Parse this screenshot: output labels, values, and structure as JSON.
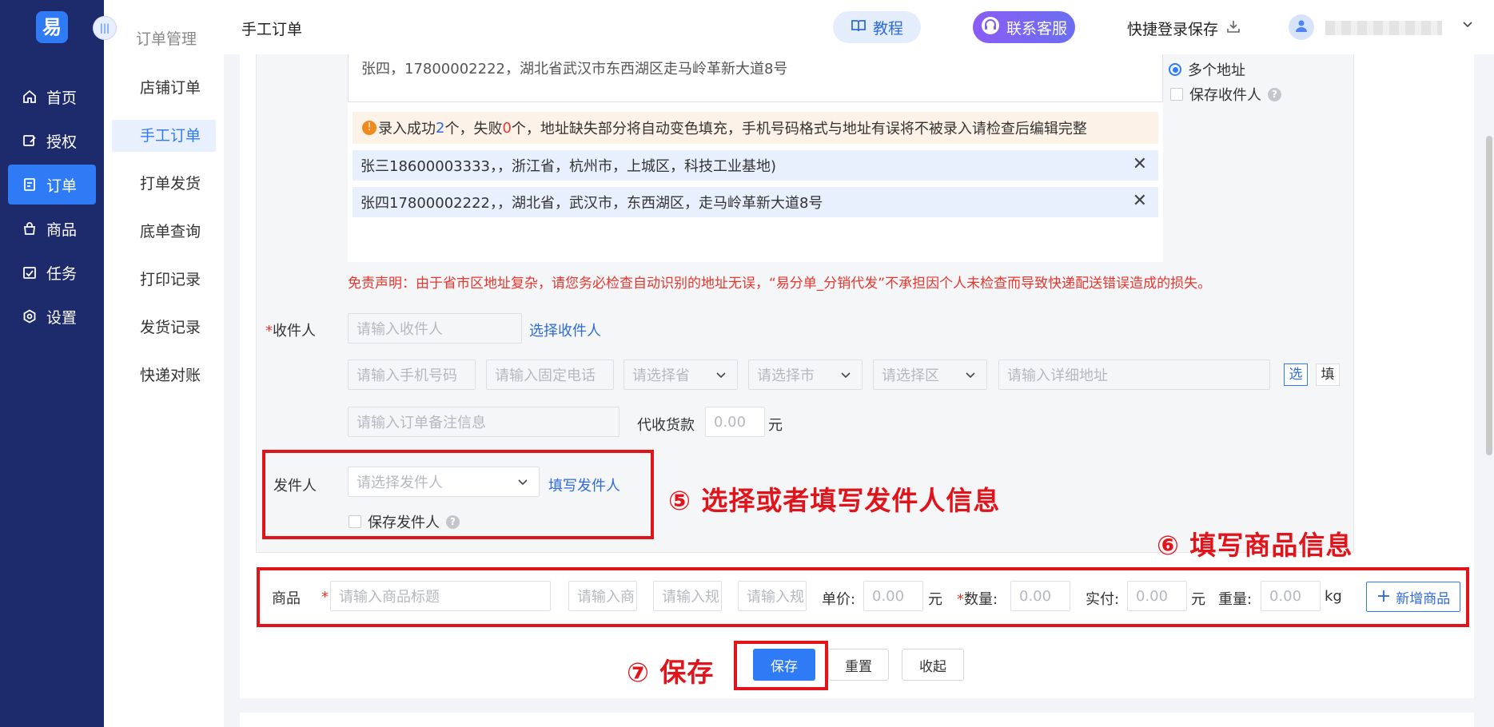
{
  "sidebar": {
    "logo": "易",
    "items": [
      {
        "label": "首页",
        "icon": "home-icon"
      },
      {
        "label": "授权",
        "icon": "auth-icon"
      },
      {
        "label": "订单",
        "icon": "order-icon",
        "active": true
      },
      {
        "label": "商品",
        "icon": "product-icon"
      },
      {
        "label": "任务",
        "icon": "task-icon"
      },
      {
        "label": "设置",
        "icon": "settings-icon"
      }
    ]
  },
  "subnav": {
    "title": "订单管理",
    "items": [
      {
        "label": "店铺订单"
      },
      {
        "label": "手工订单",
        "active": true
      },
      {
        "label": "打单发货"
      },
      {
        "label": "底单查询"
      },
      {
        "label": "打印记录"
      },
      {
        "label": "发货记录"
      },
      {
        "label": "快递对账"
      }
    ]
  },
  "topbar": {
    "page_title": "手工订单",
    "tutorial_label": "教程",
    "service_label": "联系客服",
    "quick_login_label": "快捷登录保存"
  },
  "form": {
    "textarea_value": "张四，17800002222，湖北省武汉市东西湖区走马岭革新大道8号",
    "radio_multi_label": "多个地址",
    "save_recipient_label": "保存收件人",
    "warning": {
      "pre": "录入成功 ",
      "success_count": "2",
      "mid": " 个，失败 ",
      "fail_count": "0",
      "post": " 个，地址缺失部分将自动变色填充，手机号码格式与地址有误将不被录入请检查后编辑完整"
    },
    "addresses": [
      "张三18600003333，，浙江省，杭州市，上城区，科技工业基地)",
      "张四17800002222，，湖北省，武汉市，东西湖区，走马岭革新大道8号"
    ],
    "disclaimer": "免责声明：由于省市区地址复杂，请您务必检查自动识别的地址无误，“易分单_分销代发”不承担因个人未检查而导致快递配送错误造成的损失。",
    "recipient": {
      "required_mark": "*",
      "label": "收件人",
      "name_placeholder": "请输入收件人",
      "select_link": "选择收件人",
      "mobile_placeholder": "请输入手机号码",
      "phone_placeholder": "请输入固定电话",
      "province_placeholder": "请选择省",
      "city_placeholder": "请选择市",
      "district_placeholder": "请选择区",
      "address_placeholder": "请输入详细地址",
      "btn_select": "选",
      "btn_fill": "填",
      "remark_placeholder": "请输入订单备注信息",
      "cod_label": "代收货款",
      "cod_value": "0.00",
      "cod_unit": "元"
    },
    "sender": {
      "label": "发件人",
      "select_placeholder": "请选择发件人",
      "fill_link": "填写发件人",
      "save_label": "保存发件人"
    },
    "product": {
      "label": "商品",
      "required_mark": "*",
      "title_placeholder": "请输入商品标题",
      "field2_placeholder": "请输入商",
      "field3_placeholder": "请输入规",
      "field4_placeholder": "请输入规",
      "unit_price_label": "单价:",
      "unit_price_value": "0.00",
      "yuan": "元",
      "qty_label": "数量:",
      "qty_value": "0.00",
      "paid_label": "实付:",
      "paid_value": "0.00",
      "weight_label": "重量:",
      "weight_value": "0.00",
      "kg": "kg",
      "add_button": "新增商品"
    },
    "actions": {
      "save": "保存",
      "reset": "重置",
      "collapse": "收起"
    }
  },
  "annotations": {
    "step5": "⑤ 选择或者填写发件人信息",
    "step6": "⑥ 填写商品信息",
    "step7": "⑦ 保存"
  },
  "colors": {
    "sidebar_bg": "#1d2a6b",
    "primary": "#2f7bf6",
    "annotation_red": "#e0141b",
    "disclaimer_red": "#e6362e"
  }
}
